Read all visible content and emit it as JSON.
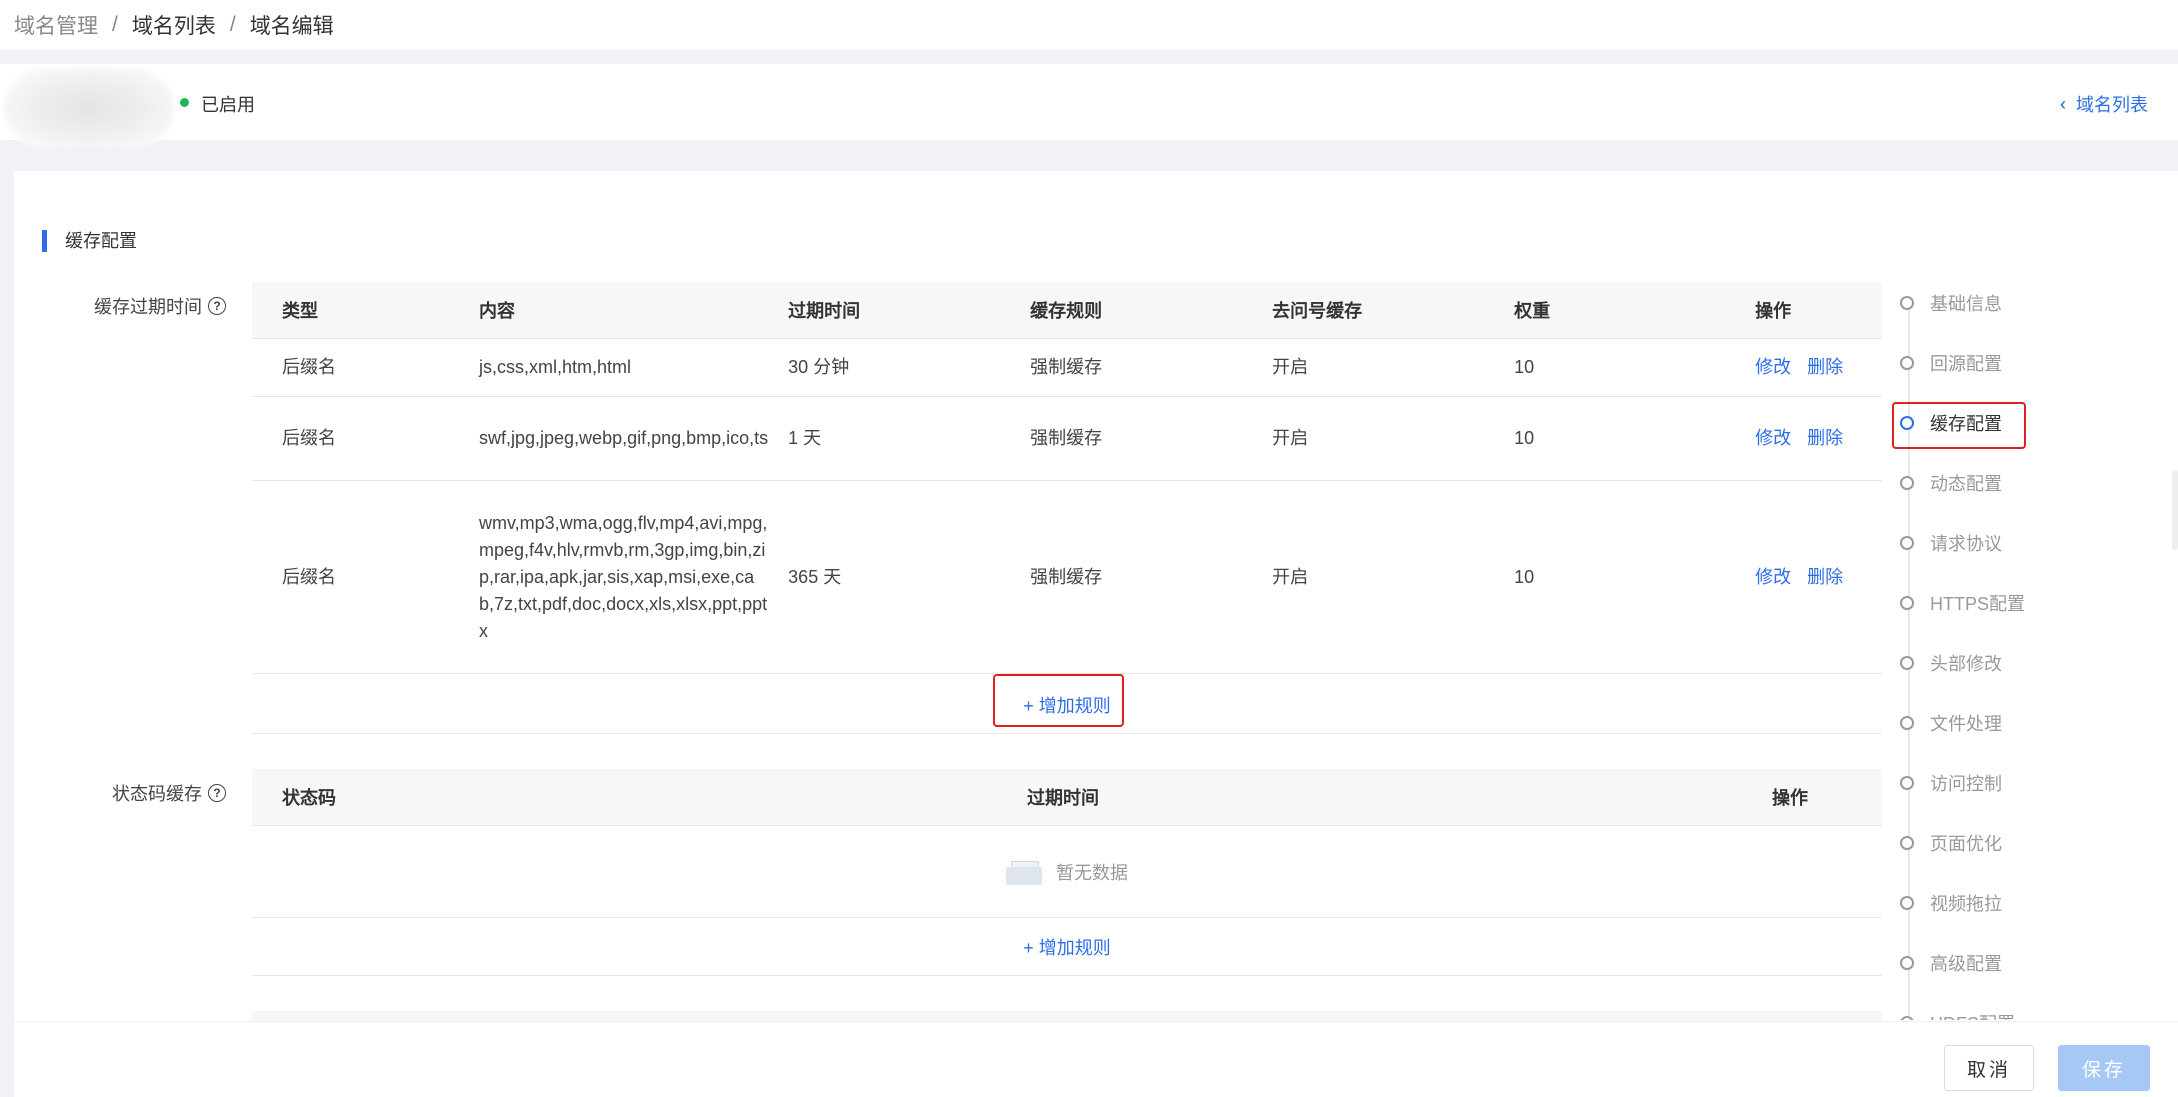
{
  "breadcrumb": {
    "items": [
      "域名管理",
      "域名列表",
      "域名编辑"
    ],
    "separator": "/"
  },
  "domain": {
    "status": "已启用",
    "status_color": "#1db954",
    "back_label": "域名列表",
    "back_icon": "double-chevron-left-icon"
  },
  "section": {
    "title": "缓存配置"
  },
  "cache_expiry": {
    "label": "缓存过期时间",
    "columns": [
      "类型",
      "内容",
      "过期时间",
      "缓存规则",
      "去问号缓存",
      "权重",
      "操作"
    ],
    "rows": [
      {
        "type": "后缀名",
        "content": "js,css,xml,htm,html",
        "expire": "30 分钟",
        "rule": "强制缓存",
        "ignore_query": "开启",
        "weight": "10",
        "edit": "修改",
        "delete": "删除"
      },
      {
        "type": "后缀名",
        "content": "swf,jpg,jpeg,webp,gif,png,bmp,ico,ts",
        "expire": "1 天",
        "rule": "强制缓存",
        "ignore_query": "开启",
        "weight": "10",
        "edit": "修改",
        "delete": "删除"
      },
      {
        "type": "后缀名",
        "content": "wmv,mp3,wma,ogg,flv,mp4,avi,mpg,mpeg,f4v,hlv,rmvb,rm,3gp,img,bin,zip,rar,ipa,apk,jar,sis,xap,msi,exe,cab,7z,txt,pdf,doc,docx,xls,xlsx,ppt,pptx",
        "expire": "365 天",
        "rule": "强制缓存",
        "ignore_query": "开启",
        "weight": "10",
        "edit": "修改",
        "delete": "删除"
      }
    ],
    "add_label": "+ 增加规则"
  },
  "status_cache": {
    "label": "状态码缓存",
    "columns": [
      "状态码",
      "过期时间",
      "操作"
    ],
    "empty_text": "暂无数据",
    "add_label": "+ 增加规则"
  },
  "side_nav": {
    "items": [
      "基础信息",
      "回源配置",
      "缓存配置",
      "动态配置",
      "请求协议",
      "HTTPS配置",
      "头部修改",
      "文件处理",
      "访问控制",
      "页面优化",
      "视频拖拉",
      "高级配置",
      "HDFS配置"
    ],
    "active": "缓存配置",
    "accent": "#2d6ee8"
  },
  "footer": {
    "cancel_label": "取消",
    "save_label": "保存"
  }
}
